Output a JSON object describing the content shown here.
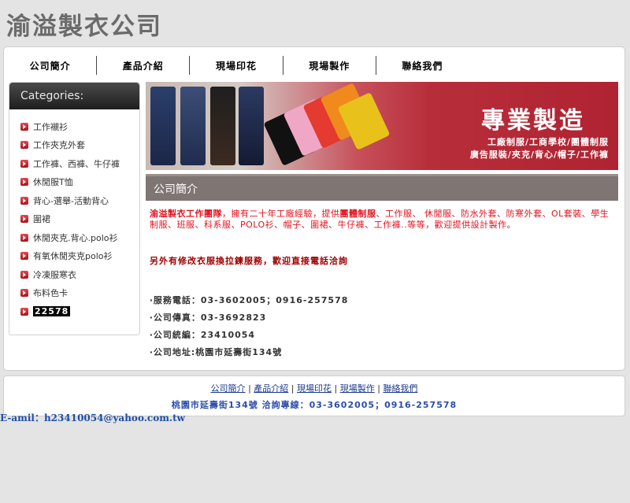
{
  "logo": {
    "text": "渝溢製衣公司"
  },
  "nav": {
    "items": [
      "公司簡介",
      "產品介紹",
      "現場印花",
      "現場製作",
      "聯絡我們"
    ]
  },
  "sidebar": {
    "title": "Categories:",
    "items": [
      "工作襯衫",
      "工作夾克外套",
      "工作褲、西褲、牛仔褲",
      "休閒服T恤",
      "背心-選舉-活動背心",
      "圍裙",
      "休閒夾克.背心.polo衫",
      "有氧休閒夾克polo衫",
      "冷凍服寒衣",
      "布料色卡",
      "22578"
    ]
  },
  "banner": {
    "title": "專業製造",
    "line1": "工廠制服/工商學校/團體制服",
    "line2": "廣告服裝/夾克/背心/帽子/工作褲"
  },
  "section": {
    "title": "公司簡介"
  },
  "content": {
    "company_name": "渝溢製衣工作團隊",
    "intro_a": "，擁有二十年工廠經驗，提供",
    "intro_bold": "團體制服",
    "intro_b": "、工作服、 休閒服、防水外套、防寒外套、OL套裝、學生制服、班服、科系服、POLO衫、帽子、圍裙、牛仔褲、工作褲..等等，歡迎提供設計製作。",
    "note": "另外有修改衣服換拉鍊服務，歡迎直接電話洽詢",
    "phone": "‧服務電話：03-3602005；0916-257578",
    "fax": "‧公司傳真：03-3692823",
    "tax_id": "‧公司統編：23410054",
    "address": "‧公司地址:桃園市延壽街134號"
  },
  "footer": {
    "links": [
      "公司簡介",
      "產品介紹",
      "現場印花",
      "現場製作",
      "聯絡我們"
    ],
    "separator": "|",
    "contact": "桃園市延壽街134號 洽詢專線：03-3602005；0916-257578"
  },
  "email": {
    "text": "E-amil：h23410054@yahoo.com.tw"
  },
  "colors": {
    "accent_red": "#e3121e",
    "sidebar_header": "#2a2a2a",
    "section_header": "#7f7572",
    "link_blue": "#1c3a8a"
  }
}
